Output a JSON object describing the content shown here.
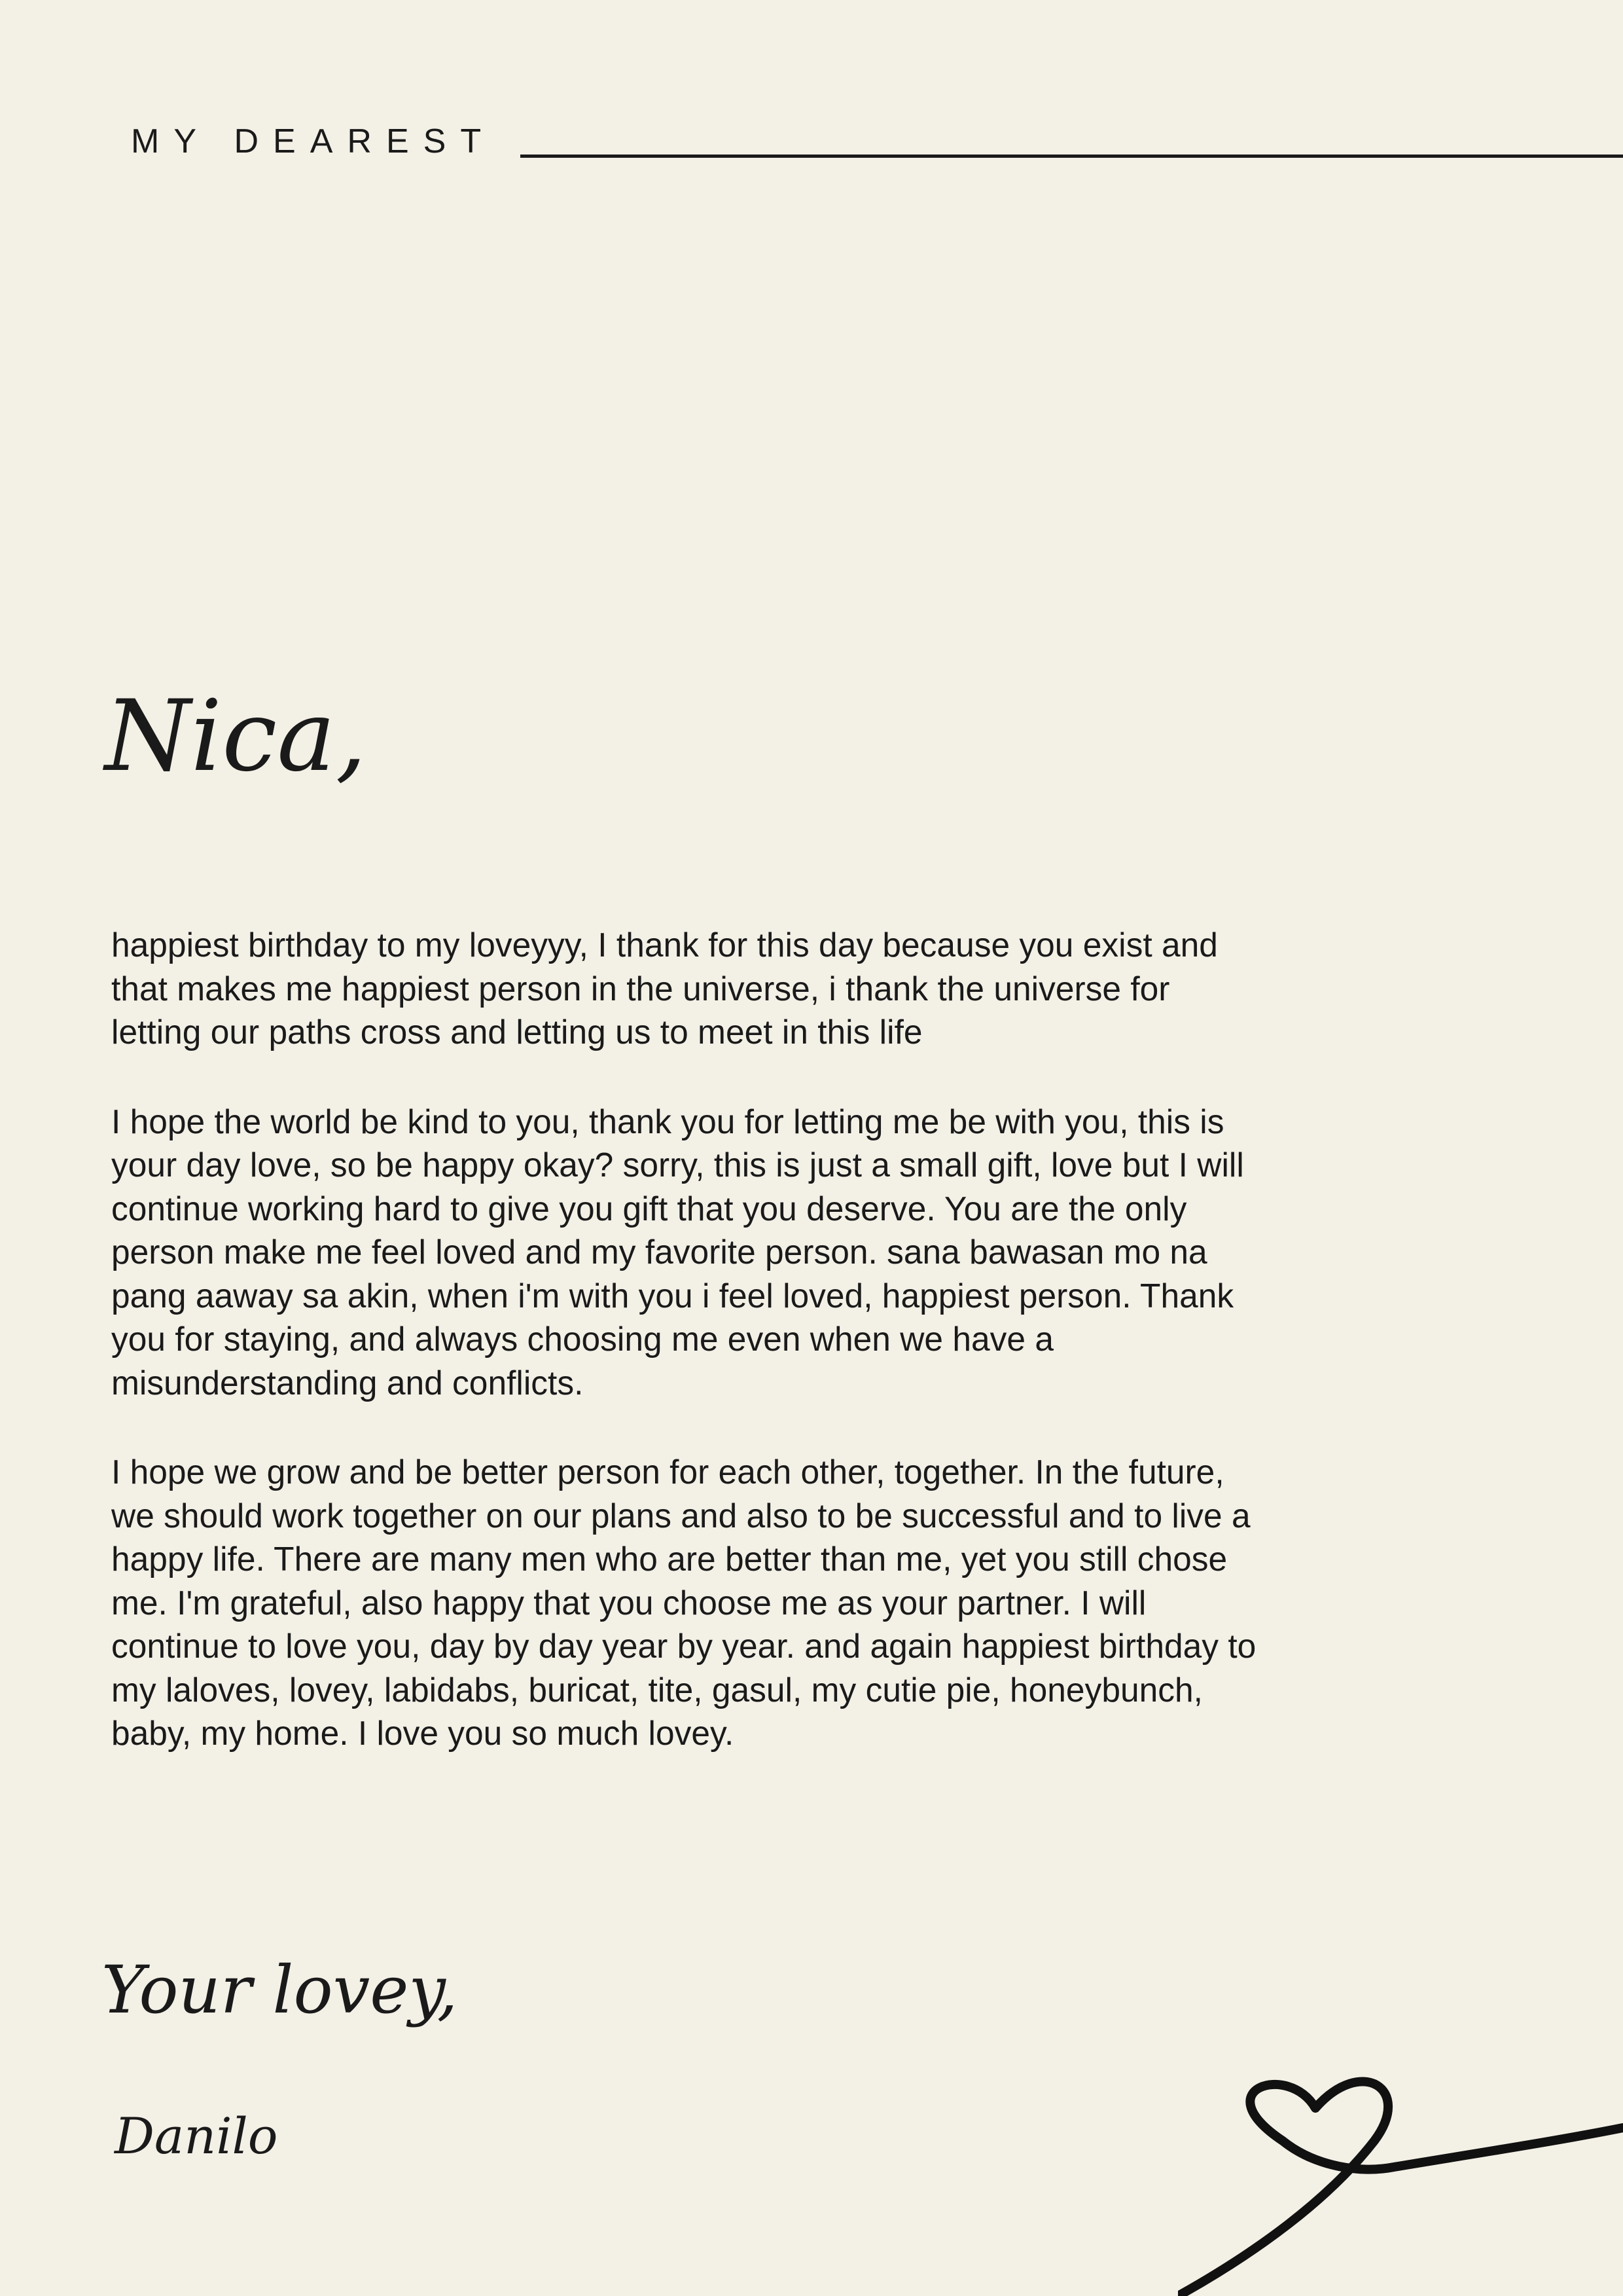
{
  "header": {
    "label": "MY DEAREST"
  },
  "letter": {
    "salutation": "Nica,",
    "paragraphs": [
      "happiest birthday to my loveyyy, I thank for this day because you exist and that makes me happiest person in the universe, i thank the universe for letting our paths cross and letting us to meet in this life",
      "I hope the world be kind to you, thank you for letting me be with you, this is your day love, so be happy okay? sorry, this is just a small gift, love but I will continue working hard to give you gift that you deserve. You are the only person make me feel loved and my favorite person. sana bawasan mo na pang aaway sa akin, when i'm with you i feel loved, happiest person. Thank you for staying, and always choosing me even when we have a misunderstanding and conflicts.",
      "I hope we grow and be better person for each other, together. In the future, we should work together on our plans and also to be successful and to live a happy life. There are many men who are better than me, yet you still chose me. I'm grateful, also happy that you choose me as your partner. I will continue to love you, day by day year by year. and again happiest birthday to my laloves, lovey, labidabs, buricat, tite, gasul, my cutie pie, honeybunch, baby, my home. I love you so much lovey."
    ],
    "closing": "Your lovey,",
    "signature": "Danilo"
  },
  "decoration": {
    "icon": "heart-line-icon",
    "color": "#111111"
  }
}
